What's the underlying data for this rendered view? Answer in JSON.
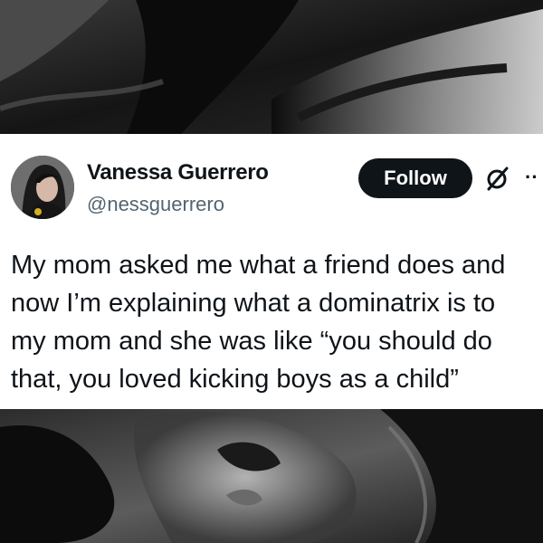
{
  "tweet": {
    "author_name": "Vanessa Guerrero",
    "author_handle": "@nessguerrero",
    "follow_label": "Follow",
    "text": "My mom asked me what a friend does and\nnow I’m explaining what a dominatrix is to\nmy mom and she was like “you should do\nthat, you loved kicking boys as a child”",
    "icons": {
      "grok": "slashed-circle-icon",
      "more": "more-dots-icon"
    }
  },
  "colors": {
    "text_primary": "#0f1419",
    "text_secondary": "#536471",
    "button_bg": "#0f1419",
    "card_bg": "#ffffff",
    "background": "#1a1a1a"
  }
}
